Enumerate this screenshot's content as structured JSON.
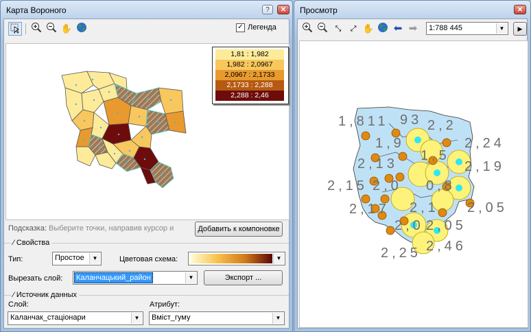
{
  "left": {
    "title": "Карта Вороного",
    "legend_checkbox_label": "Легенда",
    "legend_checked": true,
    "legend_items": [
      {
        "label": "1,81 : 1,982",
        "color": "#fdeb9a"
      },
      {
        "label": "1,982 : 2,0967",
        "color": "#f8c75d"
      },
      {
        "label": "2,0967 : 2,1733",
        "color": "#e89a2e"
      },
      {
        "label": "2,1733 : 2,288",
        "color": "#b65a12"
      },
      {
        "label": "2,288 : 2,46",
        "color": "#6e0c0c"
      }
    ],
    "hint_label": "Подсказка:",
    "hint_text": "Выберите точки, направив курсор и",
    "add_layout_button": "Добавить к компоновке",
    "properties_section": "Свойства",
    "type_label": "Тип:",
    "type_value": "Простое",
    "color_scheme_label": "Цветовая схема:",
    "color_scheme_colors": [
      "#fffdd8",
      "#f7c24c",
      "#d37a1c",
      "#5a0707"
    ],
    "clip_layer_label": "Вырезать слой:",
    "clip_layer_value": "Каланчацький_район",
    "export_button": "Экспорт ...",
    "data_source_section": "Источник данных",
    "layer_label": "Слой:",
    "layer_value": "Каланчак_стаціонари",
    "attribute_label": "Атрибут:",
    "attribute_value": "Вміст_гуму"
  },
  "right": {
    "title": "Просмотр",
    "scale": "1:788 445",
    "point_labels": [
      "1,811",
      "93",
      "2,2",
      "1,9",
      "2,24",
      "2,13",
      "1,5",
      "2,19",
      "2,15",
      "2,0",
      "0,8",
      "2,17",
      "2,1",
      "2,05",
      "2,0",
      "2,05",
      "2,25",
      "2,46"
    ]
  }
}
